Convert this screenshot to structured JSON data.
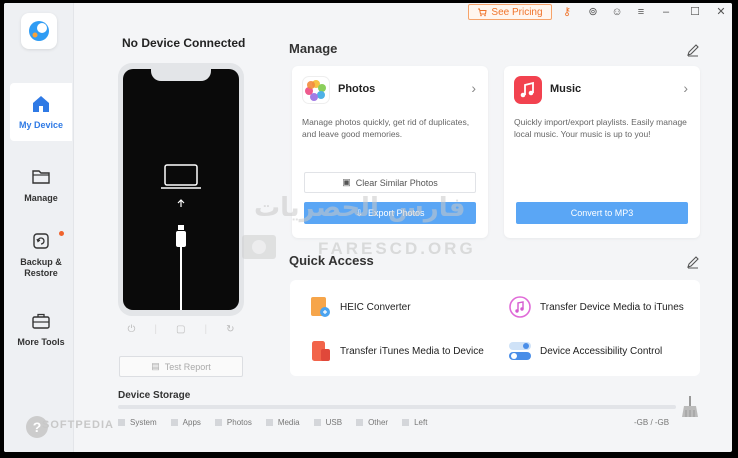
{
  "titlebar": {
    "see_pricing": "See Pricing",
    "icons": [
      "key-icon",
      "download-icon",
      "feedback-icon",
      "menu-icon",
      "minimize-icon",
      "maximize-icon",
      "close-icon"
    ]
  },
  "sidebar": {
    "items": [
      {
        "label": "My Device",
        "icon": "home-icon",
        "active": true
      },
      {
        "label": "Manage",
        "icon": "folder-icon"
      },
      {
        "label": "Backup & Restore",
        "icon": "backup-icon",
        "badge": true
      },
      {
        "label": "More Tools",
        "icon": "toolbox-icon"
      }
    ],
    "help": "?"
  },
  "device": {
    "title": "No Device Connected",
    "test_report": "Test Report"
  },
  "storage": {
    "title": "Device Storage",
    "legend": [
      "System",
      "Apps",
      "Photos",
      "Media",
      "USB",
      "Other",
      "Left"
    ],
    "size": "-GB / -GB"
  },
  "manage": {
    "title": "Manage",
    "photos": {
      "title": "Photos",
      "desc": "Manage photos quickly, get rid of duplicates, and leave good memories.",
      "clear_btn": "Clear Similar Photos",
      "export_btn": "Export Photos"
    },
    "music": {
      "title": "Music",
      "desc": "Quickly import/export playlists. Easily manage local music. Your music is up to you!",
      "convert_btn": "Convert to MP3"
    }
  },
  "quick_access": {
    "title": "Quick Access",
    "items": [
      "HEIC Converter",
      "Transfer Device Media to iTunes",
      "Transfer iTunes Media to Device",
      "Device Accessibility Control"
    ]
  },
  "watermark": {
    "arabic": "فارس الحصريات",
    "url": "FARESCD.ORG"
  },
  "softpedia": "SOFTPEDIA",
  "colors": {
    "accent": "#2f7ae5",
    "primary_button": "#5aa6f5",
    "pricing": "#f0742b"
  }
}
